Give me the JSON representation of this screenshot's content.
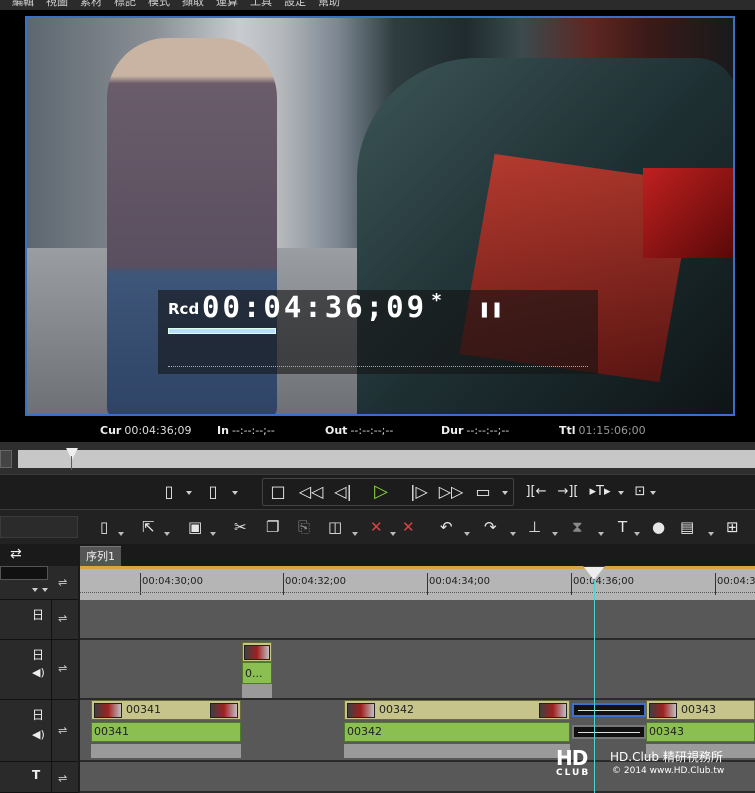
{
  "menu": [
    "編輯",
    "視圖",
    "素材",
    "標記",
    "模式",
    "擷取",
    "運算",
    "工具",
    "設定",
    "幫助"
  ],
  "viewer": {
    "timecode_label": "Rcd",
    "timecode_value": "00:04:36;09",
    "timecode_flag": "*",
    "pause_glyph": "❚❚",
    "cur_label": "Cur",
    "cur_value": "00:04:36;09",
    "in_label": "In",
    "in_value": "--:--:--;--",
    "out_label": "Out",
    "out_value": "--:--:--;--",
    "dur_label": "Dur",
    "dur_value": "--:--:--;--",
    "ttl_label": "Ttl",
    "ttl_value": "01:15:06;00"
  },
  "transport": {
    "icons": [
      "set-in-icon",
      "set-out-icon",
      "stop-icon",
      "rewind-icon",
      "step-back-icon",
      "play-icon",
      "step-forward-icon",
      "fast-forward-icon",
      "loop-icon",
      "mark-in-edit-icon",
      "mark-out-edit-icon",
      "split-icon",
      "match-frame-icon"
    ]
  },
  "timeline": {
    "tab_label": "序列1",
    "ruler_labels": [
      "00:04:30;00",
      "00:04:32;00",
      "00:04:34;00",
      "00:04:36;00",
      "00:04:3"
    ],
    "tracks": {
      "title_track": {
        "clip_label": "0..."
      },
      "av_track": {
        "video_clips": [
          "00341",
          "00342",
          "00343"
        ],
        "audio_clips": [
          "00341",
          "00342",
          "00343"
        ]
      }
    }
  },
  "watermark": {
    "logo": "HD",
    "club": "CLUB",
    "name": "HD.Club 精研視務所",
    "copyright": "© 2014  www.HD.Club.tw"
  },
  "colors": {
    "accent_blue": "#3a6fc8",
    "play_green": "#8bd43a",
    "video_clip": "#c6c48a",
    "audio_clip": "#8cbf52",
    "cursor": "#4bd4d4"
  }
}
